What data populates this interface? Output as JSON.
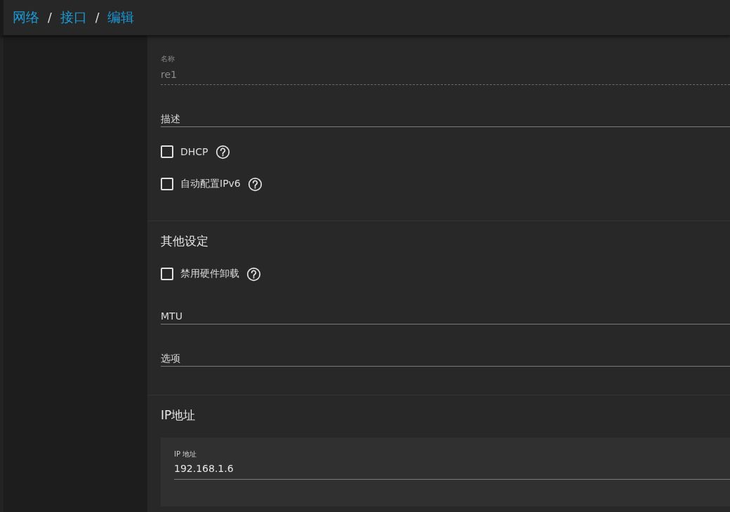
{
  "breadcrumb": [
    {
      "kind": "link",
      "text": "网络"
    },
    {
      "kind": "separator",
      "text": "/"
    },
    {
      "kind": "link",
      "text": "接口"
    },
    {
      "kind": "separator",
      "text": "/"
    },
    {
      "kind": "link",
      "text": "编辑"
    }
  ],
  "sections": [
    {
      "items": [
        {
          "kind": "field",
          "label": "名称",
          "value": "re1",
          "disabled": true
        },
        {
          "kind": "input",
          "placeholder": "描述"
        },
        {
          "kind": "checkbox",
          "label": "DHCP",
          "checked": false,
          "help": true
        },
        {
          "kind": "checkbox",
          "label": "自动配置IPv6",
          "checked": false,
          "help": true
        }
      ]
    },
    {
      "title": "其他设定",
      "items": [
        {
          "kind": "checkbox",
          "label": "禁用硬件卸载",
          "checked": false,
          "help": true
        },
        {
          "kind": "input",
          "placeholder": "MTU"
        },
        {
          "kind": "input",
          "placeholder": "选项"
        }
      ]
    },
    {
      "title": "IP地址",
      "items": [
        {
          "kind": "card_field",
          "label": "IP 地址",
          "value": "192.168.1.6",
          "disabled": false
        }
      ]
    }
  ]
}
